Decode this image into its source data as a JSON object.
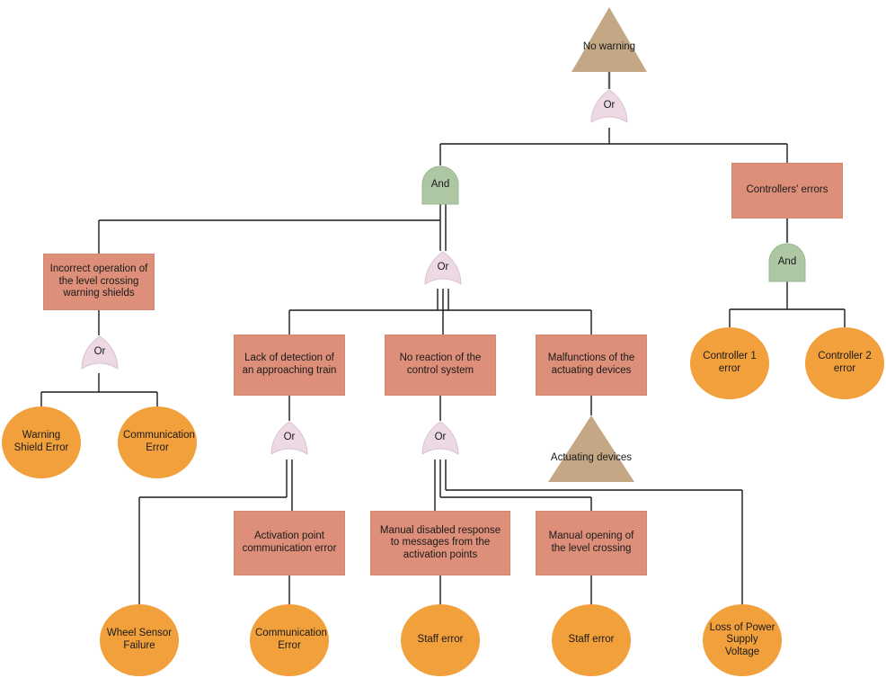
{
  "diagram": {
    "title": "No warning fault tree",
    "type": "fault-tree",
    "colors": {
      "box_fill": "#dd8f7a",
      "circle_fill": "#f2a03c",
      "triangle_fill": "#c4a886",
      "or_gate_fill": "#ecd9e4",
      "and_gate_fill": "#adc6a4",
      "edge": "#1a1a1a",
      "top_edge": "#5a5a5a",
      "background": "#ffffff"
    }
  },
  "nodes": {
    "top_event": {
      "label": "No warning",
      "shape": "triangle"
    },
    "gate_top": {
      "label": "Or",
      "shape": "or-gate"
    },
    "gate_and_main": {
      "label": "And",
      "shape": "and-gate"
    },
    "controllers_errors": {
      "label": "Controllers' errors",
      "shape": "box"
    },
    "gate_and_controllers": {
      "label": "And",
      "shape": "and-gate"
    },
    "controller1": {
      "label": "Controller 1 error",
      "shape": "circle"
    },
    "controller2": {
      "label": "Controller 2 error",
      "shape": "circle"
    },
    "incorrect_operation": {
      "label": "Incorrect operation of the level crossing warning shields",
      "shape": "box"
    },
    "gate_or_incorrect": {
      "label": "Or",
      "shape": "or-gate"
    },
    "warning_shield_error": {
      "label": "Warning Shield Error",
      "shape": "circle"
    },
    "communication_error_1": {
      "label": "Communication Error",
      "shape": "circle"
    },
    "gate_or_mid": {
      "label": "Or",
      "shape": "or-gate"
    },
    "lack_of_detection": {
      "label": "Lack of detection of an approaching train",
      "shape": "box"
    },
    "no_reaction": {
      "label": "No reaction of the control system",
      "shape": "box"
    },
    "malfunctions": {
      "label": "Malfunctions of the actuating devices",
      "shape": "box"
    },
    "actuating_devices": {
      "label": "Actuating devices",
      "shape": "triangle"
    },
    "gate_or_lack": {
      "label": "Or",
      "shape": "or-gate"
    },
    "gate_or_noreaction": {
      "label": "Or",
      "shape": "or-gate"
    },
    "activation_point": {
      "label": "Activation point communication error",
      "shape": "box"
    },
    "manual_disabled": {
      "label": "Manual disabled response to messages from the activation points",
      "shape": "box"
    },
    "manual_opening": {
      "label": "Manual opening of the level crossing",
      "shape": "box"
    },
    "wheel_sensor_failure": {
      "label": "Wheel Sensor Failure",
      "shape": "circle"
    },
    "communication_error_2": {
      "label": "Communication Error",
      "shape": "circle"
    },
    "staff_error_1": {
      "label": "Staff error",
      "shape": "circle"
    },
    "staff_error_2": {
      "label": "Staff error",
      "shape": "circle"
    },
    "loss_of_power": {
      "label": "Loss of Power Supply Voltage",
      "shape": "circle"
    }
  }
}
